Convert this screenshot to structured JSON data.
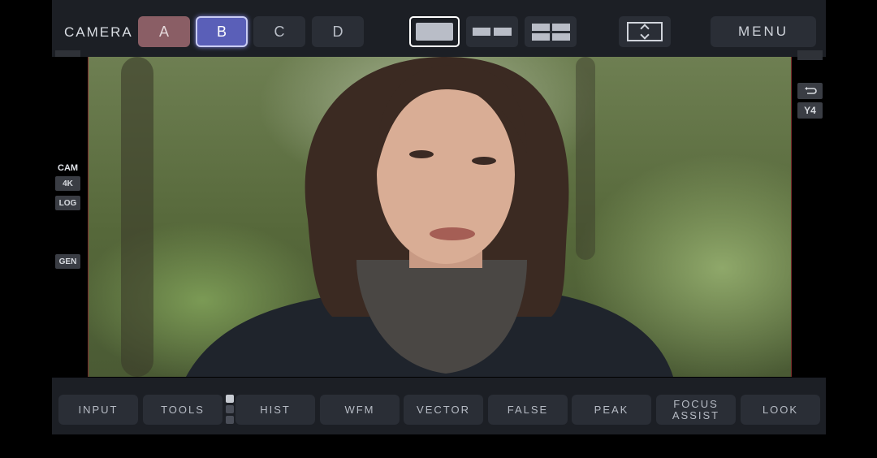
{
  "top": {
    "camera_label": "CAMERA",
    "cameras": [
      "A",
      "B",
      "C",
      "D"
    ],
    "selected_camera": "B",
    "layouts": [
      "single",
      "dual",
      "quad"
    ],
    "selected_layout": "single",
    "menu_label": "MENU"
  },
  "left_status": {
    "cam": "CAM",
    "res": "4K",
    "log": "LOG",
    "gen": "GEN"
  },
  "right_status": {
    "y": "Y4"
  },
  "tools": [
    {
      "label": "INPUT"
    },
    {
      "label": "TOOLS"
    },
    {
      "label": "HIST"
    },
    {
      "label": "WFM"
    },
    {
      "label": "VECTOR"
    },
    {
      "label": "FALSE"
    },
    {
      "label": "PEAK"
    },
    {
      "label": "FOCUS ASSIST"
    },
    {
      "label": "LOOK"
    }
  ],
  "colors": {
    "accent": "#5a5fb8",
    "camera_a": "#8a5e65",
    "bar_bg": "#1c1f25",
    "button_bg": "#2a2e36"
  }
}
